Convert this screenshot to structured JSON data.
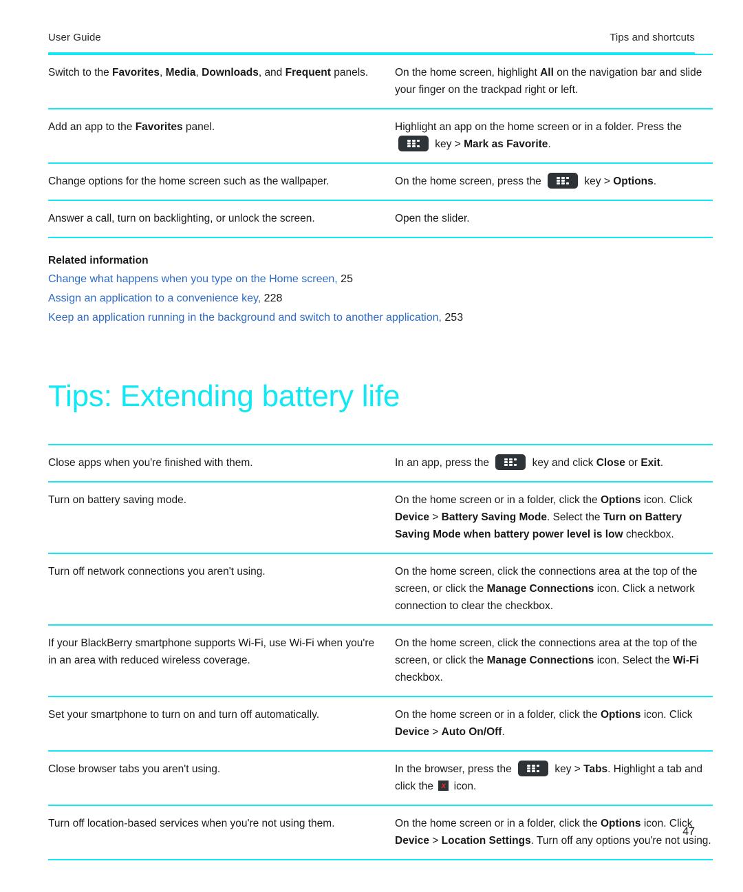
{
  "document": {
    "running_head_left": "User Guide",
    "running_head_right": "Tips and shortcuts",
    "page_number": "47"
  },
  "colors": {
    "accent_cyan": "#12e7f4",
    "link_blue": "#2f6bc4",
    "body_text": "#1a1a1a",
    "key_icon_bg": "#2d3337",
    "close_icon_red": "#e8262b"
  },
  "top_table": {
    "rows": [
      {
        "task": {
          "segments": [
            {
              "text": "Switch to the ",
              "bold": false
            },
            {
              "text": "Favorites",
              "bold": true
            },
            {
              "text": ", ",
              "bold": false
            },
            {
              "text": "Media",
              "bold": true
            },
            {
              "text": ", ",
              "bold": false
            },
            {
              "text": "Downloads",
              "bold": true
            },
            {
              "text": ", and ",
              "bold": false
            },
            {
              "text": "Frequent",
              "bold": true
            },
            {
              "text": " panels.",
              "bold": false
            }
          ]
        },
        "action": {
          "segments": [
            {
              "text": "On the home screen, highlight ",
              "bold": false
            },
            {
              "text": "All",
              "bold": true
            },
            {
              "text": " on the navigation bar and slide your finger on the trackpad right or left.",
              "bold": false
            }
          ]
        }
      },
      {
        "task": {
          "segments": [
            {
              "text": "Add an app to the ",
              "bold": false
            },
            {
              "text": "Favorites",
              "bold": true
            },
            {
              "text": " panel.",
              "bold": false
            }
          ]
        },
        "action": {
          "segments": [
            {
              "text": "Highlight an app on the home screen or in a folder. Press the ",
              "bold": false
            },
            {
              "icon": "blackberry-menu-key-icon"
            },
            {
              "text": " key > ",
              "bold": false
            },
            {
              "text": "Mark as Favorite",
              "bold": true
            },
            {
              "text": ".",
              "bold": false
            }
          ]
        }
      },
      {
        "task": {
          "segments": [
            {
              "text": "Change options for the home screen such as the wallpaper.",
              "bold": false
            }
          ]
        },
        "action": {
          "segments": [
            {
              "text": "On the home screen, press the ",
              "bold": false
            },
            {
              "icon": "blackberry-menu-key-icon"
            },
            {
              "text": " key > ",
              "bold": false
            },
            {
              "text": "Options",
              "bold": true
            },
            {
              "text": ".",
              "bold": false
            }
          ]
        }
      },
      {
        "task": {
          "segments": [
            {
              "text": "Answer a call, turn on backlighting, or unlock the screen.",
              "bold": false
            }
          ]
        },
        "action": {
          "segments": [
            {
              "text": "Open the slider.",
              "bold": false
            }
          ]
        }
      }
    ]
  },
  "related_information": {
    "title": "Related information",
    "links": [
      {
        "text": "Change what happens when you type on the Home screen,",
        "page": " 25"
      },
      {
        "text": "Assign an application to a convenience key,",
        "page": " 228"
      },
      {
        "text": "Keep an application running in the background and switch to another application,",
        "page": " 253"
      }
    ]
  },
  "chapter": {
    "heading": "Tips: Extending battery life"
  },
  "battery_table": {
    "rows": [
      {
        "task": {
          "segments": [
            {
              "text": "Close apps when you're finished with them.",
              "bold": false
            }
          ]
        },
        "action": {
          "segments": [
            {
              "text": "In an app, press the ",
              "bold": false
            },
            {
              "icon": "blackberry-menu-key-icon"
            },
            {
              "text": " key and click ",
              "bold": false
            },
            {
              "text": "Close",
              "bold": true
            },
            {
              "text": " or ",
              "bold": false
            },
            {
              "text": "Exit",
              "bold": true
            },
            {
              "text": ".",
              "bold": false
            }
          ]
        }
      },
      {
        "task": {
          "segments": [
            {
              "text": "Turn on battery saving mode.",
              "bold": false
            }
          ]
        },
        "action": {
          "segments": [
            {
              "text": "On the home screen or in a folder, click the ",
              "bold": false
            },
            {
              "text": "Options",
              "bold": true
            },
            {
              "text": " icon. Click ",
              "bold": false
            },
            {
              "text": "Device",
              "bold": true
            },
            {
              "text": " > ",
              "bold": false
            },
            {
              "text": "Battery Saving Mode",
              "bold": true
            },
            {
              "text": ". Select the ",
              "bold": false
            },
            {
              "text": "Turn on Battery Saving Mode when battery power level is low",
              "bold": true
            },
            {
              "text": " checkbox.",
              "bold": false
            }
          ]
        }
      },
      {
        "task": {
          "segments": [
            {
              "text": "Turn off network connections you aren't using.",
              "bold": false
            }
          ]
        },
        "action": {
          "segments": [
            {
              "text": "On the home screen, click the connections area at the top of the screen, or click the ",
              "bold": false
            },
            {
              "text": "Manage Connections",
              "bold": true
            },
            {
              "text": " icon. Click a network connection to clear the checkbox.",
              "bold": false
            }
          ]
        }
      },
      {
        "task": {
          "segments": [
            {
              "text": "If your BlackBerry smartphone supports Wi-Fi, use Wi-Fi when you're in an area with reduced wireless coverage.",
              "bold": false
            }
          ]
        },
        "action": {
          "segments": [
            {
              "text": "On the home screen, click the connections area at the top of the screen, or click the ",
              "bold": false
            },
            {
              "text": "Manage Connections",
              "bold": true
            },
            {
              "text": " icon. Select the ",
              "bold": false
            },
            {
              "text": "Wi-Fi",
              "bold": true
            },
            {
              "text": " checkbox.",
              "bold": false
            }
          ]
        }
      },
      {
        "task": {
          "segments": [
            {
              "text": "Set your smartphone to turn on and turn off automatically.",
              "bold": false
            }
          ]
        },
        "action": {
          "segments": [
            {
              "text": "On the home screen or in a folder, click the ",
              "bold": false
            },
            {
              "text": "Options",
              "bold": true
            },
            {
              "text": " icon. Click ",
              "bold": false
            },
            {
              "text": "Device",
              "bold": true
            },
            {
              "text": " > ",
              "bold": false
            },
            {
              "text": "Auto On/Off",
              "bold": true
            },
            {
              "text": ".",
              "bold": false
            }
          ]
        }
      },
      {
        "task": {
          "segments": [
            {
              "text": "Close browser tabs you aren't using.",
              "bold": false
            }
          ]
        },
        "action": {
          "segments": [
            {
              "text": "In the browser, press the ",
              "bold": false
            },
            {
              "icon": "blackberry-menu-key-icon"
            },
            {
              "text": " key > ",
              "bold": false
            },
            {
              "text": "Tabs",
              "bold": true
            },
            {
              "text": ". Highlight a tab and click the ",
              "bold": false
            },
            {
              "icon": "close-tab-icon",
              "glyph": "x"
            },
            {
              "text": " icon.",
              "bold": false
            }
          ]
        }
      },
      {
        "task": {
          "segments": [
            {
              "text": "Turn off location-based services when you're not using them.",
              "bold": false
            }
          ]
        },
        "action": {
          "segments": [
            {
              "text": "On the home screen or in a folder, click the ",
              "bold": false
            },
            {
              "text": "Options",
              "bold": true
            },
            {
              "text": " icon. Click ",
              "bold": false
            },
            {
              "text": "Device",
              "bold": true
            },
            {
              "text": " > ",
              "bold": false
            },
            {
              "text": "Location Settings",
              "bold": true
            },
            {
              "text": ". Turn off any options you're not using.",
              "bold": false
            }
          ]
        }
      }
    ]
  }
}
